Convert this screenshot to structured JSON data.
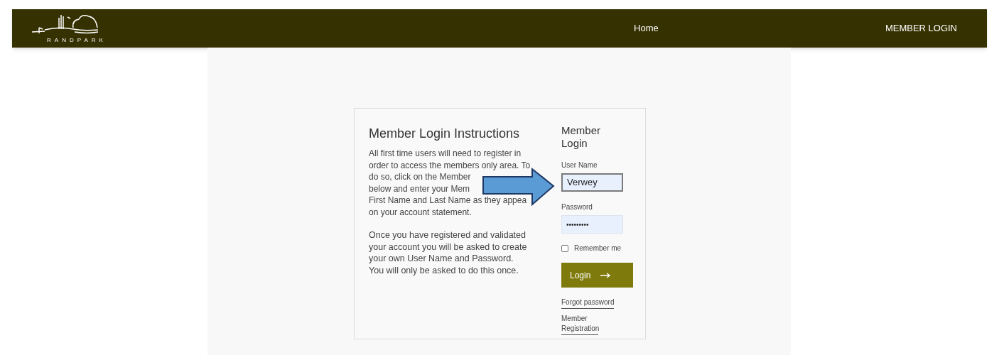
{
  "header": {
    "logo_text": "RANDPARK",
    "nav": [
      {
        "label": "Home"
      },
      {
        "label": "MEMBER LOGIN"
      }
    ]
  },
  "instructions": {
    "title": "Member Login Instructions",
    "paragraph_1_lines": [
      "All first time users will need to register in",
      "order to access the members only area. To",
      "do so, click on the Member",
      "below and enter your Mem",
      "First Name and Last Name as they appea",
      "on your account statement."
    ],
    "paragraph_2": "Once you have registered and validated your account you will be asked to create your own User Name and Password. You will only be asked to do this once."
  },
  "login": {
    "title": "Member Login",
    "fields": [
      {
        "label": "User Name",
        "value": "Verwey",
        "kind": "text",
        "focused": true
      },
      {
        "label": "Password",
        "value": "•••••••••",
        "kind": "password",
        "focused": false
      }
    ],
    "remember": {
      "label": "Remember me",
      "checked": false
    },
    "button": "Login",
    "links": [
      "Forgot password",
      "Member Registration"
    ]
  }
}
